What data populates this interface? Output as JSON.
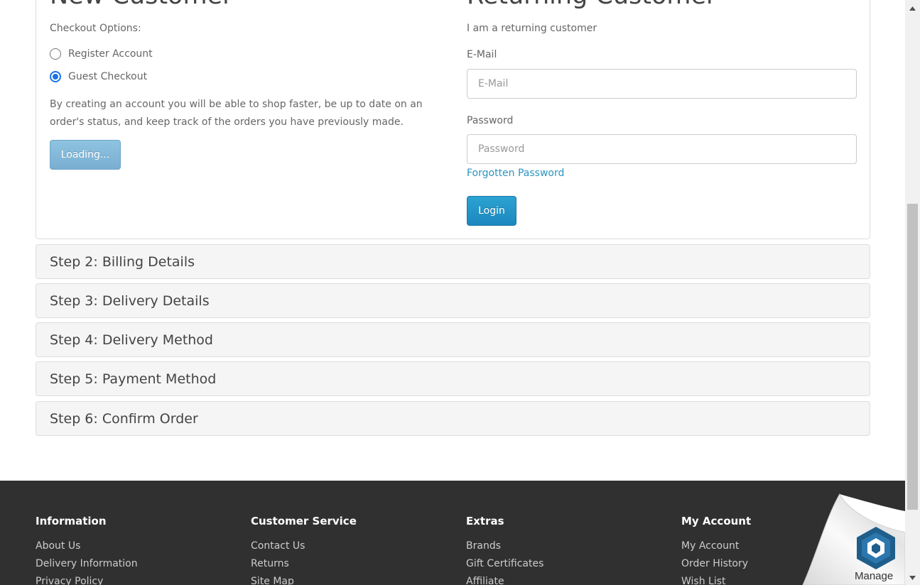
{
  "new_customer": {
    "heading": "New Customer",
    "options_label": "Checkout Options:",
    "options": [
      {
        "label": "Register Account",
        "checked": false
      },
      {
        "label": "Guest Checkout",
        "checked": true
      }
    ],
    "description": "By creating an account you will be able to shop faster, be up to date on an order's status, and keep track of the orders you have previously made.",
    "continue_button": "Loading..."
  },
  "returning_customer": {
    "heading": "Returning Customer",
    "intro": "I am a returning customer",
    "email_label": "E-Mail",
    "email_placeholder": "E-Mail",
    "email_value": "",
    "password_label": "Password",
    "password_placeholder": "Password",
    "password_value": "",
    "forgotten_link": "Forgotten Password",
    "login_button": "Login"
  },
  "steps": [
    "Step 2: Billing Details",
    "Step 3: Delivery Details",
    "Step 4: Delivery Method",
    "Step 5: Payment Method",
    "Step 6: Confirm Order"
  ],
  "footer": {
    "columns": [
      {
        "title": "Information",
        "links": [
          "About Us",
          "Delivery Information",
          "Privacy Policy"
        ]
      },
      {
        "title": "Customer Service",
        "links": [
          "Contact Us",
          "Returns",
          "Site Map"
        ]
      },
      {
        "title": "Extras",
        "links": [
          "Brands",
          "Gift Certificates",
          "Affiliate"
        ]
      },
      {
        "title": "My Account",
        "links": [
          "My Account",
          "Order History",
          "Wish List"
        ]
      }
    ]
  },
  "manage_badge": {
    "label": "Manage"
  },
  "colors": {
    "link": "#2a94c1",
    "footer_bg": "#303030",
    "step_bg": "#f5f5f5",
    "login_button": "#229ac8",
    "loading_button": "#84b9da",
    "radio_checked": "#1a73e8",
    "badge": "#1f5e8a"
  }
}
